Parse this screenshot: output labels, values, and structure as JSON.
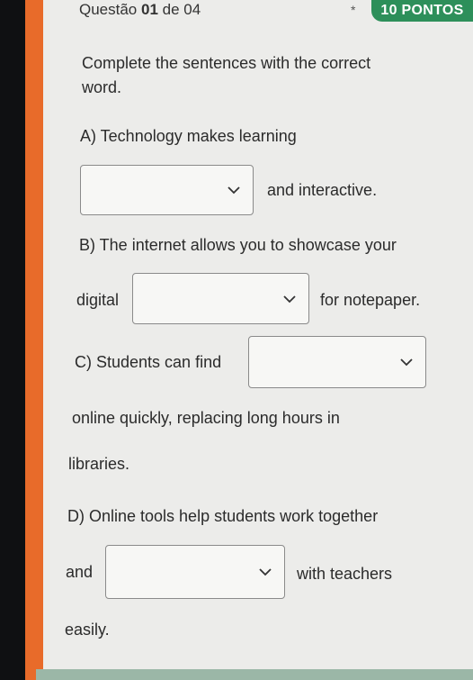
{
  "header": {
    "question_prefix": "Questão",
    "question_number": "01",
    "question_suffix": "de 04",
    "required_mark": "*",
    "points": "10 PONTOS"
  },
  "instructions": [
    "Complete the sentences with the correct",
    "word."
  ],
  "items": {
    "a": {
      "line1": "A) Technology makes learning",
      "after": "and interactive."
    },
    "b": {
      "line1": "B) The internet allows you to showcase your",
      "before": "digital",
      "after": "for notepaper."
    },
    "c": {
      "before": "C) Students can find",
      "line2": "online quickly, replacing long hours in",
      "line3": "libraries."
    },
    "d": {
      "line1": "D) Online tools help students work together",
      "before": "and",
      "after": "with teachers",
      "line3": "easily."
    }
  },
  "selects": {
    "a": "",
    "b": "",
    "c": "",
    "d": ""
  },
  "icons": {
    "dropdown": "chevron-down-icon"
  },
  "colors": {
    "accent_orange": "#e86b2a",
    "points_badge": "#2d8f5a"
  }
}
